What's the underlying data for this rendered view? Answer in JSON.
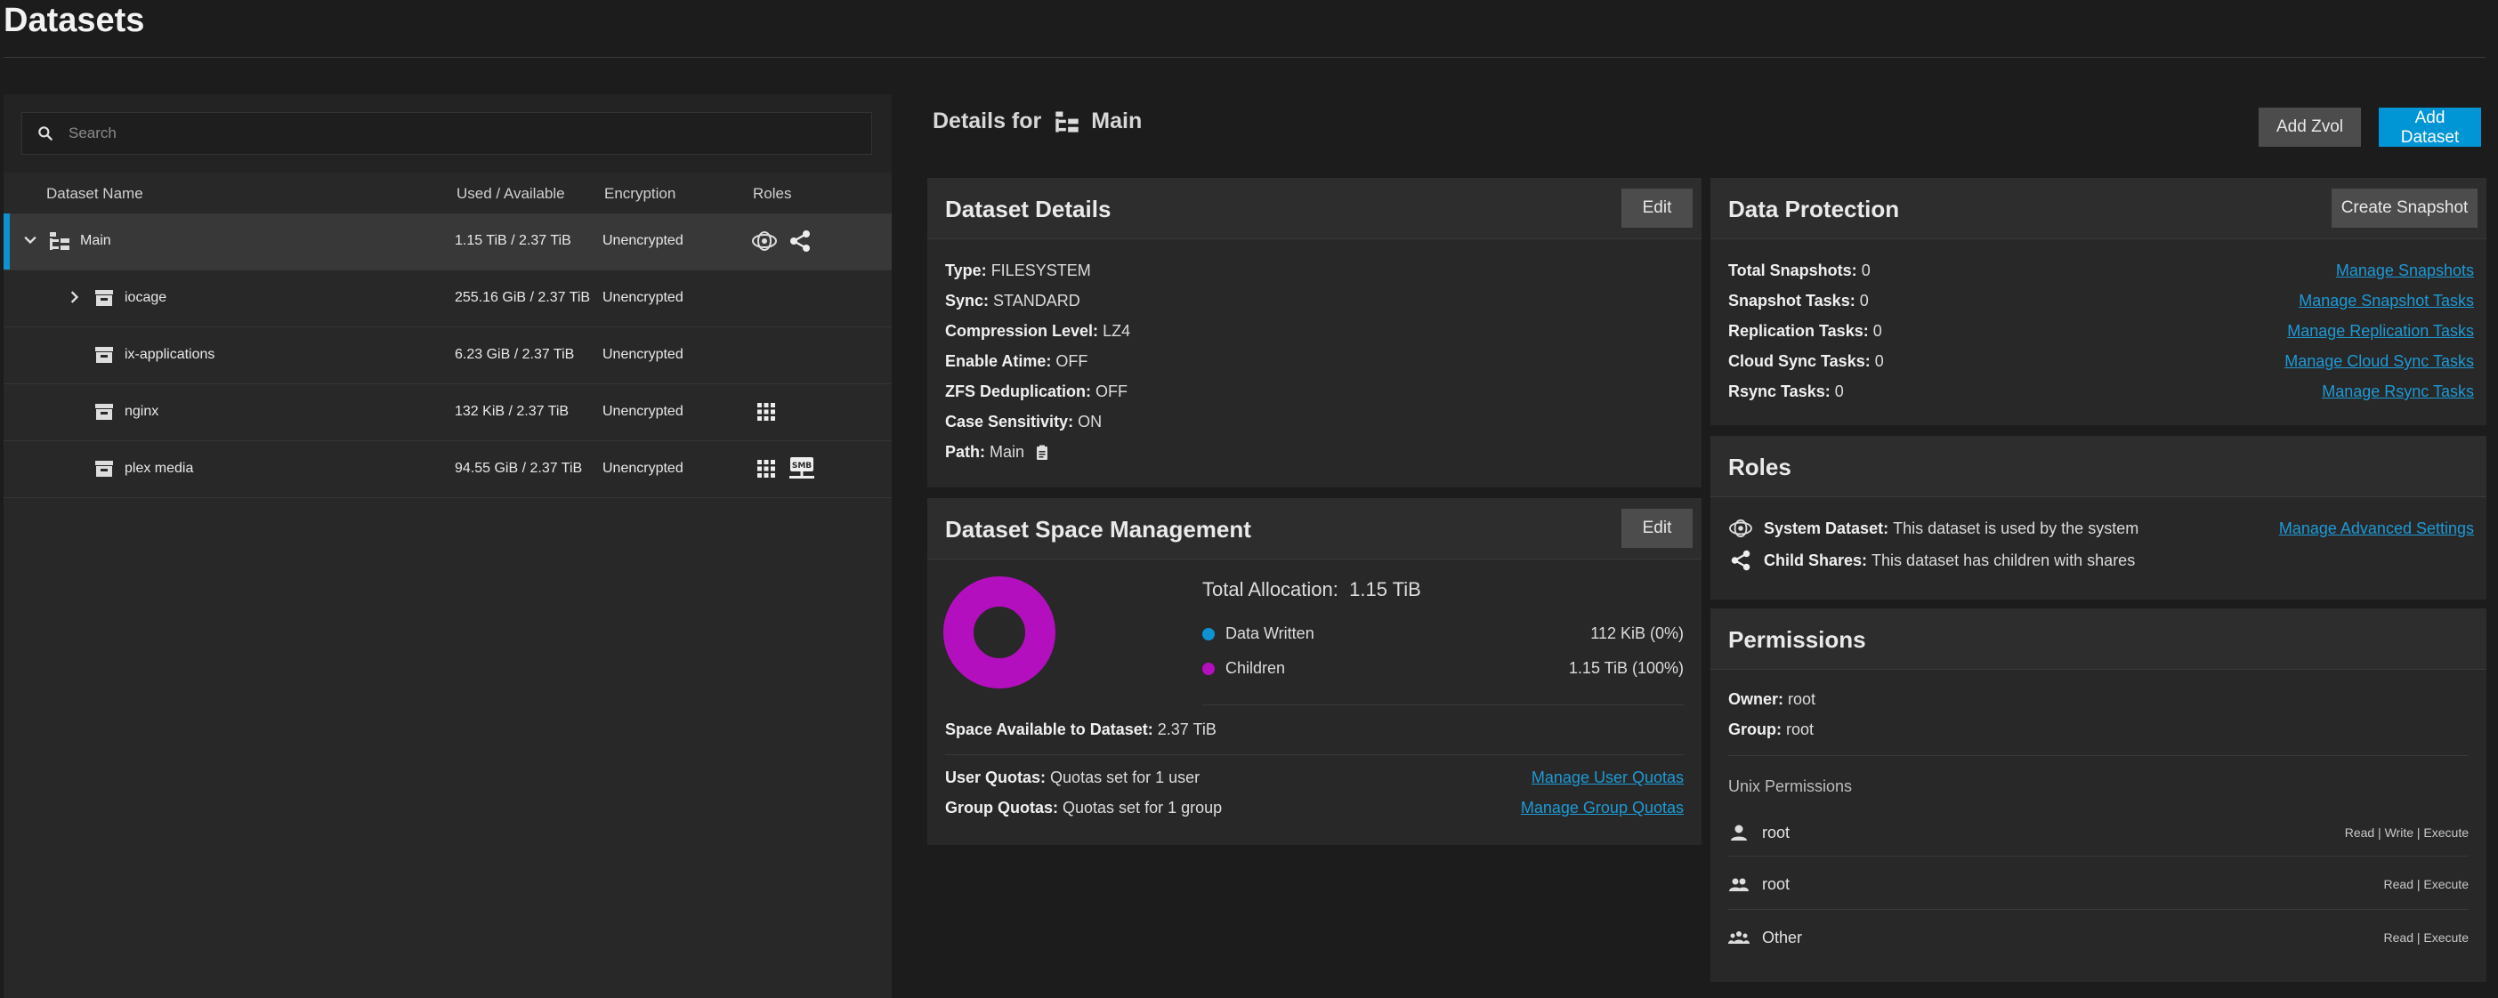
{
  "page_title": "Datasets",
  "search": {
    "placeholder": "Search"
  },
  "table": {
    "headers": {
      "name": "Dataset Name",
      "used": "Used / Available",
      "encryption": "Encryption",
      "roles": "Roles"
    },
    "rows": [
      {
        "name": "Main",
        "used": "1.15 TiB / 2.37 TiB",
        "encryption": "Unencrypted"
      },
      {
        "name": "iocage",
        "used": "255.16 GiB / 2.37 TiB",
        "encryption": "Unencrypted"
      },
      {
        "name": "ix-applications",
        "used": "6.23 GiB / 2.37 TiB",
        "encryption": "Unencrypted"
      },
      {
        "name": "nginx",
        "used": "132 KiB / 2.37 TiB",
        "encryption": "Unencrypted"
      },
      {
        "name": "plex media",
        "used": "94.55 GiB / 2.37 TiB",
        "encryption": "Unencrypted"
      }
    ]
  },
  "details": {
    "prefix": "Details for",
    "name": "Main",
    "add_zvol": "Add Zvol",
    "add_dataset": "Add Dataset"
  },
  "dataset_details": {
    "title": "Dataset Details",
    "edit": "Edit",
    "type_label": "Type:",
    "type_value": "FILESYSTEM",
    "sync_label": "Sync:",
    "sync_value": "STANDARD",
    "compression_label": "Compression Level:",
    "compression_value": "LZ4",
    "atime_label": "Enable Atime:",
    "atime_value": "OFF",
    "dedup_label": "ZFS Deduplication:",
    "dedup_value": "OFF",
    "case_label": "Case Sensitivity:",
    "case_value": "ON",
    "path_label": "Path:",
    "path_value": "Main"
  },
  "space": {
    "title": "Dataset Space Management",
    "edit": "Edit",
    "total_label": "Total Allocation:",
    "total_value": "1.15 TiB",
    "written_label": "Data Written",
    "written_value": "112 KiB (0%)",
    "children_label": "Children",
    "children_value": "1.15 TiB (100%)",
    "available_label": "Space Available to Dataset:",
    "available_value": "2.37 TiB",
    "user_quotas_label": "User Quotas:",
    "user_quotas_value": "Quotas set for 1 user",
    "group_quotas_label": "Group Quotas:",
    "group_quotas_value": "Quotas set for 1 group",
    "manage_user_quotas": "Manage User Quotas",
    "manage_group_quotas": "Manage Group Quotas",
    "colors": {
      "data_written": "#0e93d1",
      "children": "#b40fbf"
    }
  },
  "protection": {
    "title": "Data Protection",
    "create_snapshot": "Create Snapshot",
    "rows": [
      {
        "label": "Total Snapshots:",
        "value": "0",
        "link": "Manage Snapshots"
      },
      {
        "label": "Snapshot Tasks:",
        "value": "0",
        "link": "Manage Snapshot Tasks"
      },
      {
        "label": "Replication Tasks:",
        "value": "0",
        "link": "Manage Replication Tasks"
      },
      {
        "label": "Cloud Sync Tasks:",
        "value": "0",
        "link": "Manage Cloud Sync Tasks"
      },
      {
        "label": "Rsync Tasks:",
        "value": "0",
        "link": "Manage Rsync Tasks"
      }
    ]
  },
  "roles": {
    "title": "Roles",
    "system_label": "System Dataset:",
    "system_value": "This dataset is used by the system",
    "child_label": "Child Shares:",
    "child_value": "This dataset has children with shares",
    "manage_advanced": "Manage Advanced Settings"
  },
  "permissions": {
    "title": "Permissions",
    "owner_label": "Owner:",
    "owner_value": "root",
    "group_label": "Group:",
    "group_value": "root",
    "unix_label": "Unix Permissions",
    "rows": [
      {
        "name": "root",
        "perms": "Read | Write | Execute"
      },
      {
        "name": "root",
        "perms": "Read | Execute"
      },
      {
        "name": "Other",
        "perms": "Read | Execute"
      }
    ]
  }
}
